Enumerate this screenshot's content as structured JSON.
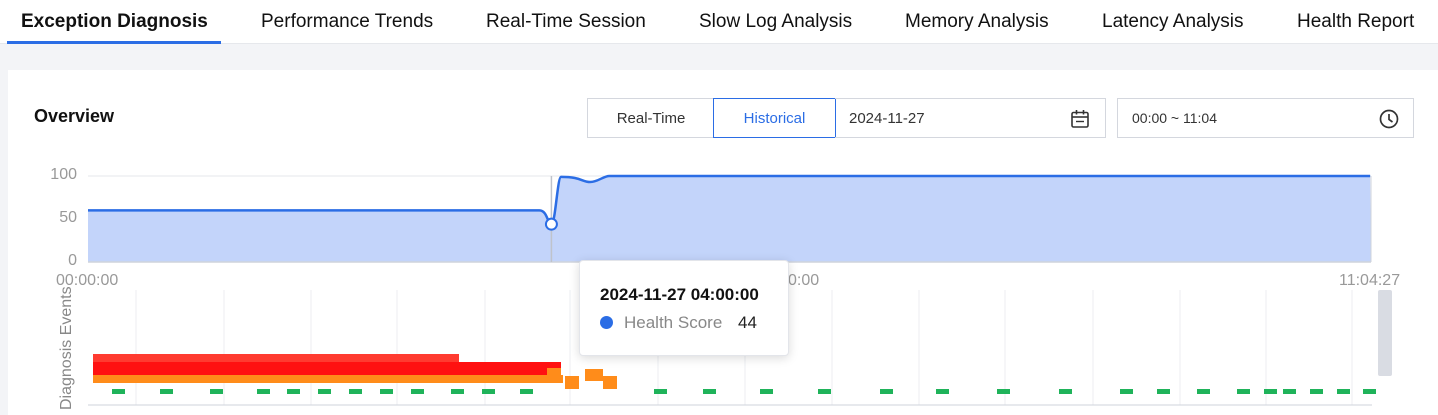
{
  "tabs": [
    {
      "label": "Exception Diagnosis",
      "active": true
    },
    {
      "label": "Performance Trends"
    },
    {
      "label": "Real-Time Session"
    },
    {
      "label": "Slow Log Analysis"
    },
    {
      "label": "Memory Analysis"
    },
    {
      "label": "Latency Analysis"
    },
    {
      "label": "Health Report"
    }
  ],
  "overview": {
    "title": "Overview",
    "mode_realtime": "Real-Time",
    "mode_historical": "Historical",
    "selected_mode": "Historical",
    "date": "2024-11-27",
    "time_range": "00:00 ~ 11:04"
  },
  "colors": {
    "accent": "#2b6de5",
    "area_fill": "#c3d4fa",
    "critical": "#ff1111",
    "error": "#ff3b30",
    "warning": "#ff8c1a",
    "healthy": "#1fb35a"
  },
  "chart_data": [
    {
      "type": "area",
      "series": [
        {
          "name": "Health Score",
          "x": [
            "00:00",
            "04:00",
            "04:05",
            "04:20",
            "04:30",
            "11:04"
          ],
          "y": [
            60,
            44,
            99,
            93,
            100,
            100
          ]
        }
      ],
      "yticks": [
        "100",
        "50",
        "0"
      ],
      "ylim": [
        0,
        100
      ],
      "x_labels": [
        "00:00:00",
        "11:04:27"
      ],
      "x_label_partial": "0:00",
      "grid": true
    },
    {
      "type": "timeline",
      "ylabel": "Diagnosis Events"
    }
  ],
  "tooltip": {
    "title": "2024-11-27 04:00:00",
    "label": "Health Score",
    "value": "44"
  }
}
